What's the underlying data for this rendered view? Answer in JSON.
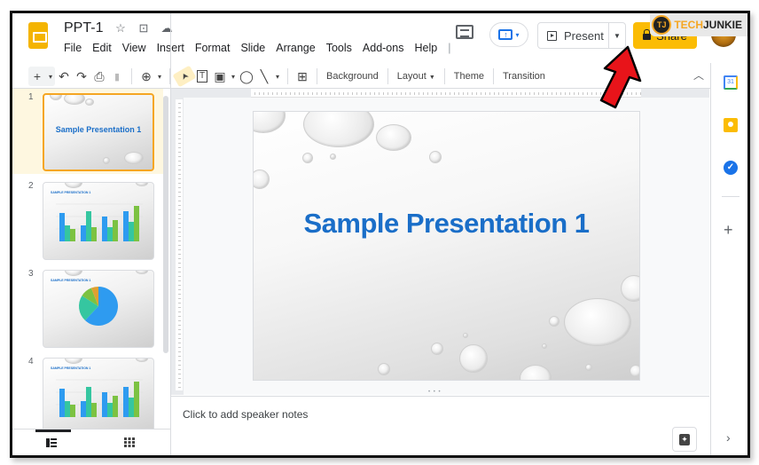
{
  "watermark": {
    "logo_letter": "TJ",
    "tech": "TECH",
    "junkie": "JUNKIE"
  },
  "header": {
    "doc_title": "PPT-1",
    "title_icons": [
      "star-icon",
      "move-to-folder-icon",
      "cloud-saved-icon"
    ],
    "menu": [
      "File",
      "Edit",
      "View",
      "Insert",
      "Format",
      "Slide",
      "Arrange",
      "Tools",
      "Add-ons",
      "Help",
      "|"
    ],
    "present_label": "Present",
    "share_label": "Share",
    "meet_icon": "present-to-meet-icon",
    "colors": {
      "share": "#fbbc04",
      "app_logo": "#f4b400",
      "accent_blue": "#1a73e8"
    }
  },
  "toolbar": {
    "buttons": [
      "new-slide",
      "new-slide-dropdown",
      "undo",
      "redo",
      "print",
      "paint-format",
      "zoom",
      "zoom-dropdown",
      "select",
      "text-box",
      "image",
      "image-dropdown",
      "shape",
      "line",
      "line-dropdown",
      "add-comment"
    ],
    "text_buttons": {
      "background": "Background",
      "layout": "Layout",
      "theme": "Theme",
      "transition": "Transition"
    },
    "glyphs": {
      "plus": "+",
      "caret": "▾",
      "undo": "↶",
      "redo": "↷",
      "print": "⎙",
      "paint": "🖌",
      "zoom": "⊕",
      "select": "➤",
      "textbox": "T",
      "image": "▣",
      "shape": "◯",
      "line": "╲",
      "comment": "⊞",
      "collapse": "︿"
    }
  },
  "filmstrip": {
    "slides": [
      {
        "number": "1",
        "title": "Sample Presentation 1",
        "type": "title",
        "selected": true
      },
      {
        "number": "2",
        "title": "SAMPLE PRESENTATION 1",
        "type": "bar-chart",
        "selected": false
      },
      {
        "number": "3",
        "title": "SAMPLE PRESENTATION 1",
        "type": "pie-chart",
        "selected": false
      },
      {
        "number": "4",
        "title": "SAMPLE PRESENTATION 1",
        "type": "bar-chart",
        "selected": false
      }
    ],
    "views": [
      "filmstrip-view-icon",
      "grid-view-icon"
    ]
  },
  "editor": {
    "slide_title": "Sample Presentation 1",
    "title_color": "#1a6ec8",
    "resize_handle": "• • •"
  },
  "notes": {
    "placeholder": "Click to add speaker notes"
  },
  "side_panel": {
    "calendar_label": "31",
    "tasks_glyph": "✓",
    "add_glyph": "+",
    "expand_glyph": "›"
  },
  "thumb_charts": {
    "bars": [
      [
        0.8,
        0.45,
        0.35
      ],
      [
        0.45,
        0.85,
        0.4
      ],
      [
        0.7,
        0.4,
        0.6
      ],
      [
        0.85,
        0.55,
        1.0
      ]
    ],
    "pie": [
      0.62,
      0.22,
      0.1,
      0.06
    ],
    "colors": [
      "#2e9bf0",
      "#35c6a0",
      "#7cc242",
      "#e0a030"
    ]
  }
}
